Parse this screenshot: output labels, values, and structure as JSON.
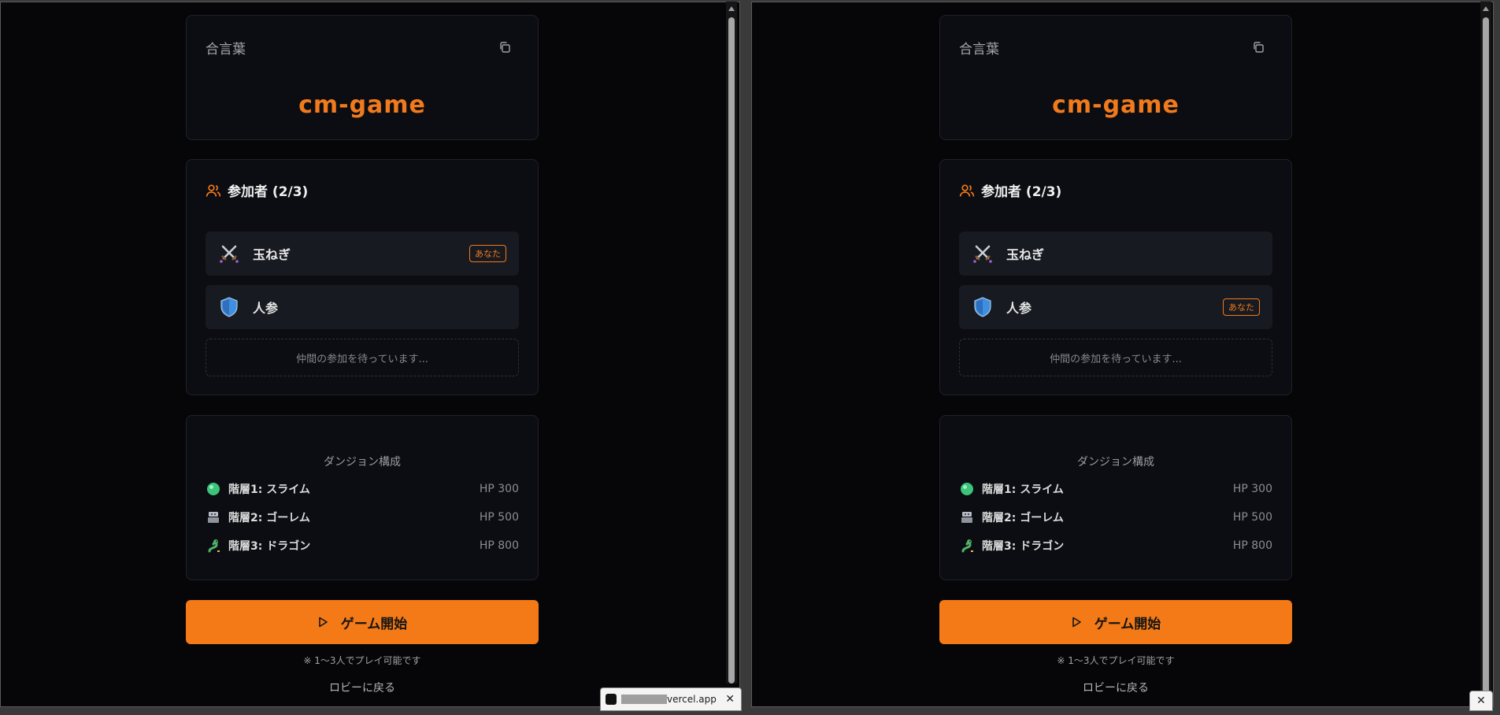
{
  "accent_color": "#f37a16",
  "panels": [
    {
      "passphrase_label": "合言葉",
      "passphrase_value": "cm-game",
      "participants": {
        "title": "参加者 (2/3)",
        "players": [
          {
            "icon": "crossed-swords-icon",
            "name": "玉ねぎ",
            "badge": "あなた"
          },
          {
            "icon": "shield-icon",
            "name": "人参",
            "badge": ""
          }
        ],
        "waiting_text": "仲間の参加を待っています..."
      },
      "dungeon": {
        "title": "ダンジョン構成",
        "floors": [
          {
            "icon": "slime-icon",
            "label": "階層1: スライム",
            "hp": "HP 300"
          },
          {
            "icon": "golem-icon",
            "label": "階層2: ゴーレム",
            "hp": "HP 500"
          },
          {
            "icon": "dragon-icon",
            "label": "階層3: ドラゴン",
            "hp": "HP 800"
          }
        ]
      },
      "start_button": "ゲーム開始",
      "note": "※ 1〜3人でプレイ可能です",
      "back_link": "ロビーに戻る"
    },
    {
      "passphrase_label": "合言葉",
      "passphrase_value": "cm-game",
      "participants": {
        "title": "参加者 (2/3)",
        "players": [
          {
            "icon": "crossed-swords-icon",
            "name": "玉ねぎ",
            "badge": ""
          },
          {
            "icon": "shield-icon",
            "name": "人参",
            "badge": "あなた"
          }
        ],
        "waiting_text": "仲間の参加を待っています..."
      },
      "dungeon": {
        "title": "ダンジョン構成",
        "floors": [
          {
            "icon": "slime-icon",
            "label": "階層1: スライム",
            "hp": "HP 300"
          },
          {
            "icon": "golem-icon",
            "label": "階層2: ゴーレム",
            "hp": "HP 500"
          },
          {
            "icon": "dragon-icon",
            "label": "階層3: ドラゴン",
            "hp": "HP 800"
          }
        ]
      },
      "start_button": "ゲーム開始",
      "note": "※ 1〜3人でプレイ可能です",
      "back_link": "ロビーに戻る"
    }
  ],
  "download_bar": {
    "file_text": "vercel.app"
  }
}
